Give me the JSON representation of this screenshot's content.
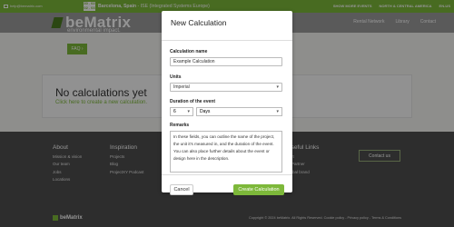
{
  "topbar": {
    "email": "help@bematrix.com",
    "date_line1": "30 . 02",
    "date_line2": "02 . 03",
    "event_location": "Barcelona, Spain",
    "event_name": " - ISE (Integrated Systems Europe)",
    "more_events": "SHOW MORE EVENTS",
    "region": "NORTH & CENTRAL AMERICA",
    "language": "EN-US"
  },
  "nav": {
    "logo_text": "beMatrix",
    "links": [
      "Rental Network",
      "Library",
      "Contact"
    ]
  },
  "page": {
    "hero_text": "environmental impact.",
    "faq_label": "FAQ ›",
    "no_calc_title": "No calculations yet",
    "no_calc_link": "Click here to create a new calculation."
  },
  "footer": {
    "col_about": {
      "title": "About",
      "items": [
        "Mission & vision",
        "Our team",
        "Jobs",
        "Locations"
      ]
    },
    "col_inspiration": {
      "title": "Inspiration",
      "items": [
        "Projects",
        "Blog",
        "ProjectXY Podcast"
      ]
    },
    "col_useful": {
      "title": "Useful Links",
      "items": [
        "port",
        "bePartner",
        "global brand"
      ]
    },
    "contact_label": "Contact us",
    "brand": "beMatrix",
    "copyright": "Copyright © 2024 beMatrix. All Rights Reserved. Cookie policy - Privacy policy - Terms & Conditions"
  },
  "modal": {
    "title": "New Calculation",
    "name_label": "Calculation name",
    "name_placeholder": "Example Calculation",
    "units_label": "Units",
    "units_value": "Imperial",
    "duration_label": "Duration of the event",
    "duration_value": "6",
    "duration_unit": "Days",
    "remarks_label": "Remarks",
    "remarks_text": "In these fields, you can outline the name of the project, the unit it's measured in, and the duration of the event. You can also place further details about the event or design here in the description.",
    "cancel_label": "Cancel",
    "create_label": "Create Calculation"
  },
  "colors": {
    "brand_green": "#7db83a",
    "footer_bg": "#4e4e4e"
  }
}
